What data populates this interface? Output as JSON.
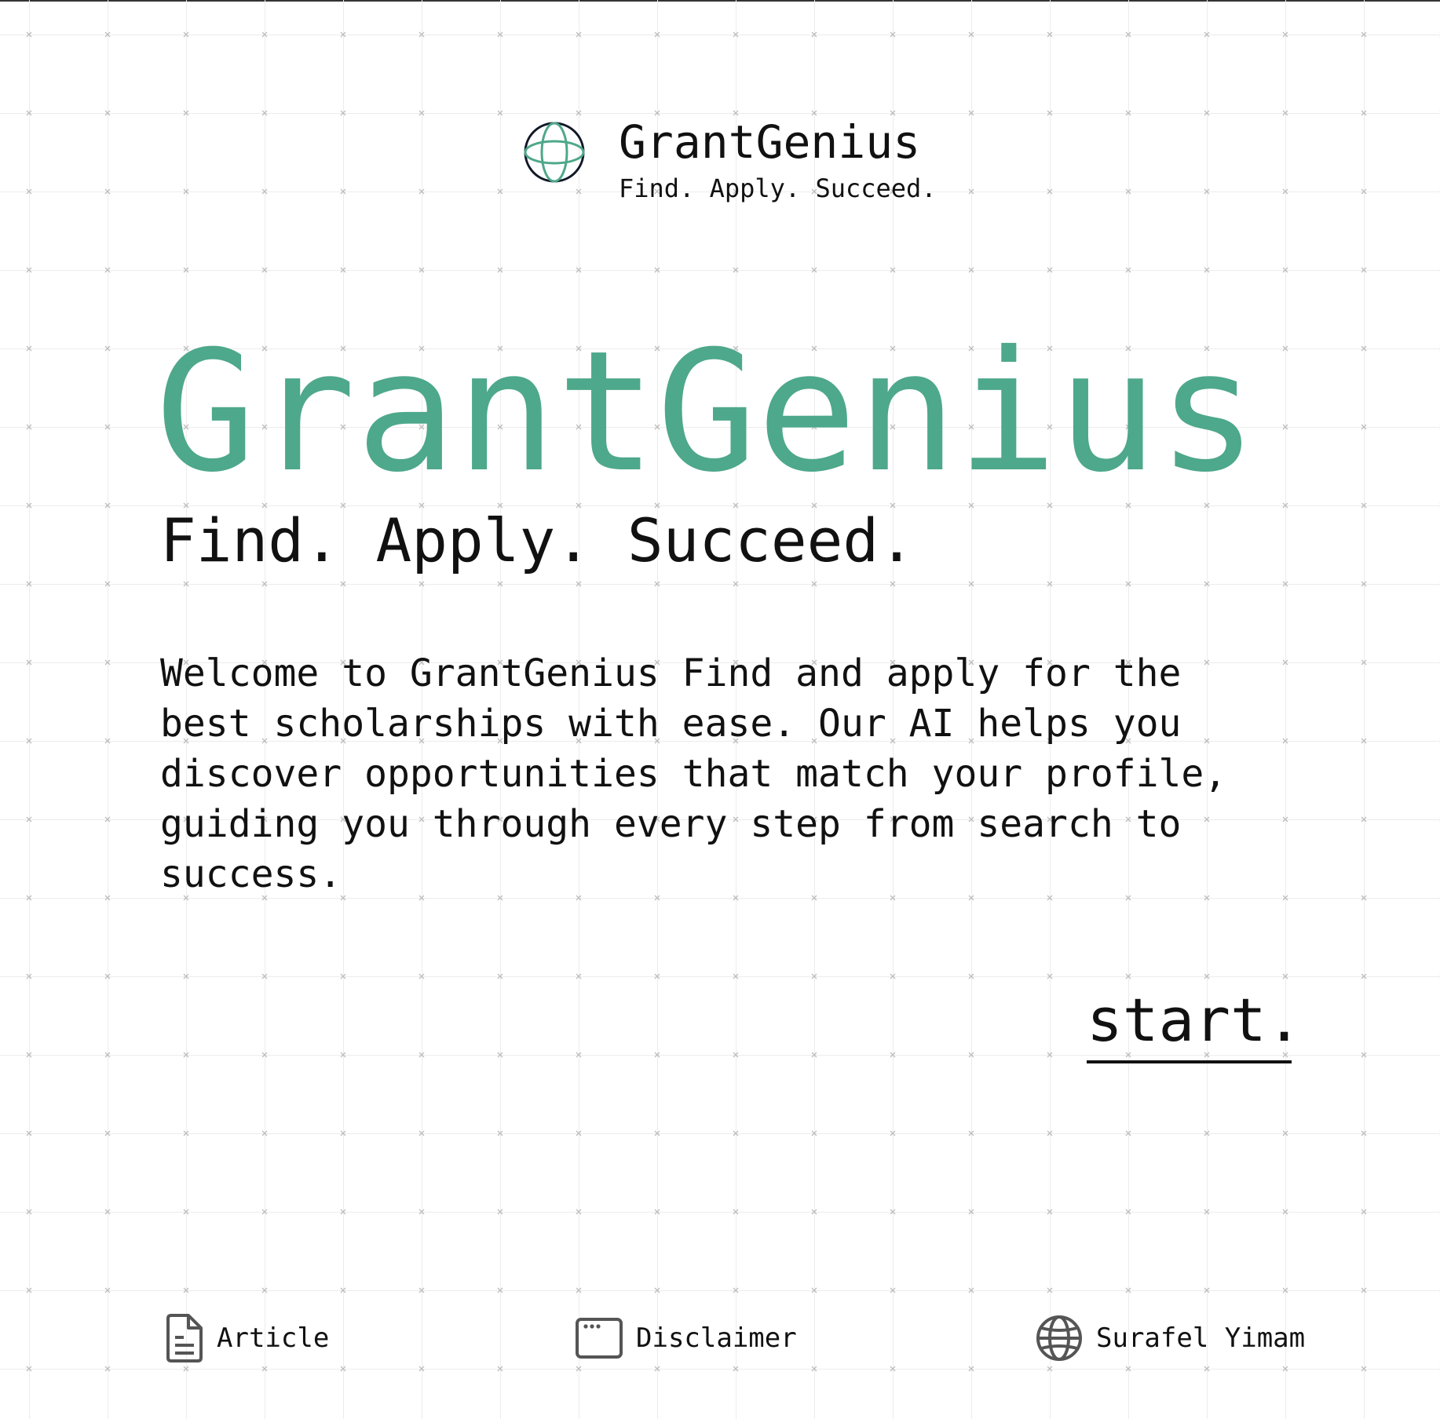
{
  "brand": {
    "name": "GrantGenius",
    "tagline": "Find. Apply. Succeed."
  },
  "hero": {
    "title": "GrantGenius",
    "subtitle": "Find. Apply. Succeed.",
    "intro": "Welcome to GrantGenius Find and apply for the best scholarships with ease. Our AI helps you discover opportunities that match your profile, guiding you through every step from search to success."
  },
  "cta": {
    "label": "start."
  },
  "footer": {
    "items": [
      {
        "label": "Article",
        "icon": "document-icon"
      },
      {
        "label": "Disclaimer",
        "icon": "browser-window-icon"
      },
      {
        "label": "Surafel Yimam",
        "icon": "globe-icon"
      }
    ]
  },
  "colors": {
    "accent": "#4ea88b",
    "text": "#111111",
    "grid_line": "#ececec",
    "grid_marker": "#b8b8b8",
    "icon_gray": "#555555"
  }
}
